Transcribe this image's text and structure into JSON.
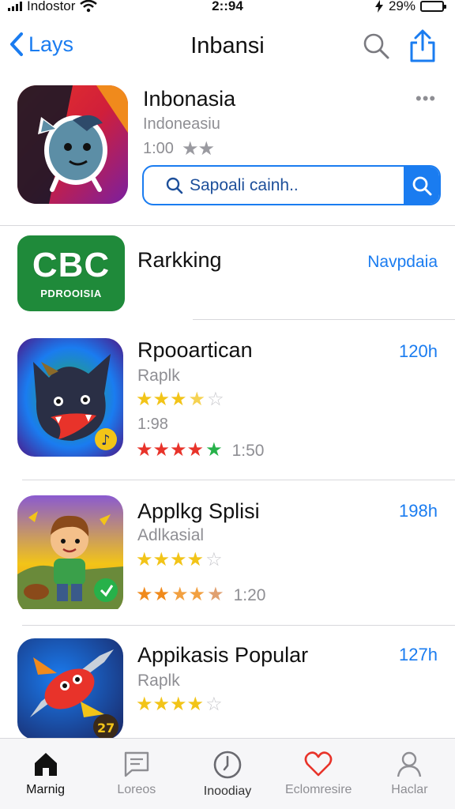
{
  "status_bar": {
    "carrier": "Indostor",
    "time": "2::94",
    "battery": "29%"
  },
  "nav": {
    "back_label": "Lays",
    "title": "Inbansi"
  },
  "featured": {
    "name": "Inbonasia",
    "subtitle": "Indoneasiu",
    "meta": "1:00",
    "stars": 2,
    "more": "•••",
    "search_placeholder": "Sapoali cainh.."
  },
  "ranking": {
    "logo_big": "CBC",
    "logo_small": "PDROOISIA",
    "title": "Rarkking",
    "link": "Navpdaia"
  },
  "apps": [
    {
      "title": "Rpooartican",
      "subtitle": "Raplk",
      "size": "120h",
      "rating_stars": 3.5,
      "rating_text": "1:98",
      "second_rating_text": "1:50"
    },
    {
      "title": "Applkg Splisi",
      "subtitle": "Adlkasial",
      "size": "198h",
      "rating_stars": 4,
      "second_rating_text": "1:20"
    },
    {
      "title": "Appikasis Popular",
      "subtitle": "Raplk",
      "size": "127h",
      "rating_stars": 4
    }
  ],
  "tabs": [
    {
      "label": "Marnig",
      "icon": "home-icon",
      "active": true
    },
    {
      "label": "Loreos",
      "icon": "message-icon",
      "active": false
    },
    {
      "label": "Inoodiay",
      "icon": "clock-icon",
      "active": false
    },
    {
      "label": "Eclomresire",
      "icon": "heart-icon",
      "active": false
    },
    {
      "label": "Haclar",
      "icon": "profile-icon",
      "active": false
    }
  ],
  "colors": {
    "accent": "#1a7cf0",
    "star_gold": "#f2c418",
    "star_red": "#e8332a",
    "star_green": "#27b14a",
    "star_orange": "#f08a1c",
    "tabbar_bg": "#f6f6f8"
  }
}
